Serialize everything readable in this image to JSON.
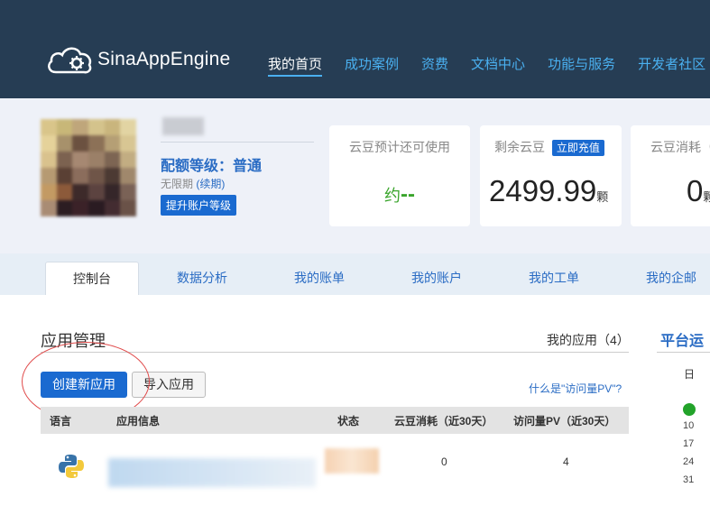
{
  "header": {
    "logo_text": "SinaAppEngine",
    "nav": [
      "我的首页",
      "成功案例",
      "资费",
      "文档中心",
      "功能与服务",
      "开发者社区"
    ]
  },
  "profile": {
    "quota_level": "配额等级：普通",
    "term_prefix": "无限期",
    "term_renew": "(续期)",
    "upgrade_label": "提升账户等级"
  },
  "cards": {
    "estimate_title": "云豆预计还可使用",
    "estimate_prefix": "约",
    "estimate_value": "--",
    "remaining_title": "剩余云豆",
    "recharge_label": "立即充值",
    "remaining_value": "2499.99",
    "unit": "颗",
    "consume_title": "云豆消耗（",
    "consume_value": "0"
  },
  "tabs": [
    "控制台",
    "数据分析",
    "我的账单",
    "我的账户",
    "我的工单",
    "我的企邮"
  ],
  "apps": {
    "title": "应用管理",
    "count_label": "我的应用（4）",
    "create_label": "创建新应用",
    "import_label": "导入应用",
    "pv_help": "什么是\"访问量PV\"?",
    "columns": [
      "语言",
      "应用信息",
      "状态",
      "云豆消耗（近30天）",
      "访问量PV（近30天）"
    ],
    "row": {
      "consume": "0",
      "pv": "4"
    }
  },
  "side": {
    "title": "平台运",
    "weekday": "日",
    "dates": [
      "10",
      "17",
      "24",
      "31"
    ]
  },
  "colors": {
    "topbar": "#263d54",
    "accent": "#1a6ad0",
    "nav_link": "#4ab0f0"
  }
}
